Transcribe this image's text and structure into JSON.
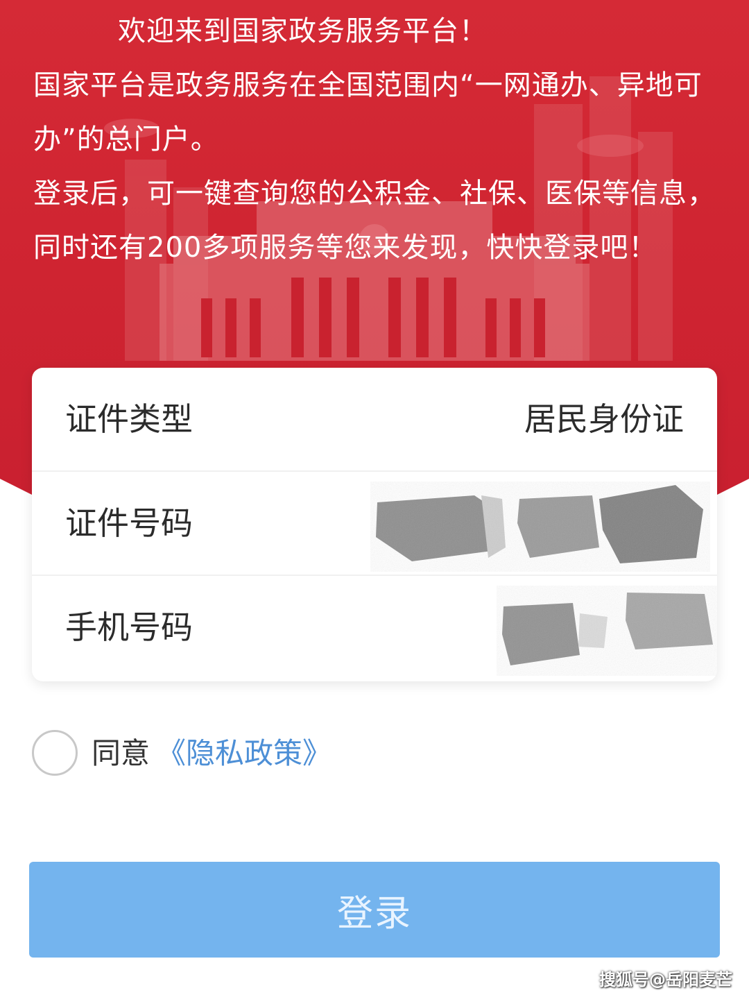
{
  "intro": {
    "welcome": "欢迎来到国家政务服务平台！",
    "paragraph1": "国家平台是政务服务在全国范围内“一网通办、异地可办”的总门户。",
    "paragraph2": "登录后，可一键查询您的公积金、社保、医保等信息，同时还有200多项服务等您来发现，快快登录吧！"
  },
  "form": {
    "id_type_label": "证件类型",
    "id_type_value": "居民身份证",
    "id_number_label": "证件号码",
    "phone_label": "手机号码"
  },
  "agree": {
    "label": "同意",
    "policy_link": "《隐私政策》"
  },
  "login": {
    "label": "登录"
  },
  "watermark": "搜狐号@岳阳麦芒",
  "colors": {
    "header_red": "#cf2431",
    "login_button": "#74b4ee",
    "link_blue": "#4d8fd6"
  }
}
